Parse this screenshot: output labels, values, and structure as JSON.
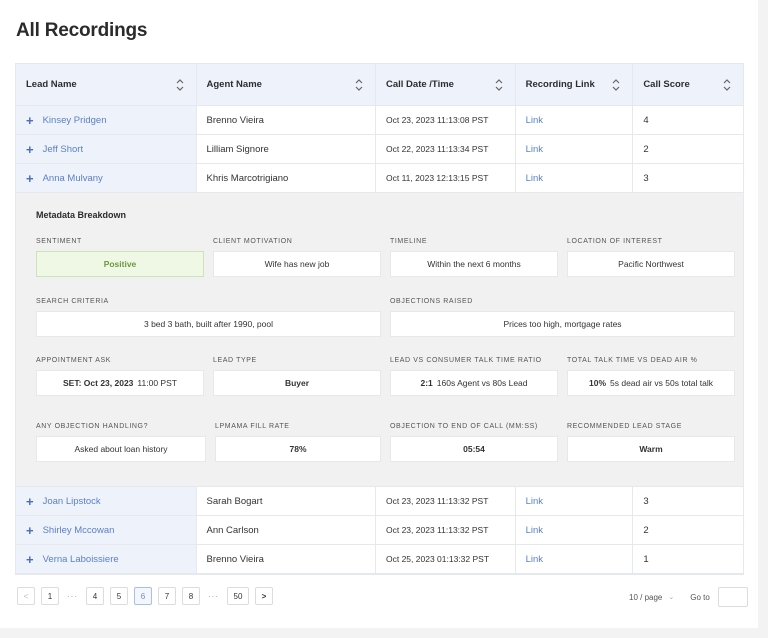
{
  "page": {
    "title": "All Recordings"
  },
  "table": {
    "columns": [
      {
        "label": "Lead Name"
      },
      {
        "label": "Agent Name"
      },
      {
        "label": "Call Date /Time"
      },
      {
        "label": "Recording Link"
      },
      {
        "label": "Call Score"
      }
    ],
    "rows_top": [
      {
        "lead": "Kinsey Pridgen",
        "agent": "Brenno Vieira",
        "date": "Oct 23, 2023  11:13:08 PST",
        "link": "Link",
        "score": "4"
      },
      {
        "lead": "Jeff Short",
        "agent": "Lilliam Signore",
        "date": "Oct 22, 2023  11:13:34 PST",
        "link": "Link",
        "score": "2"
      },
      {
        "lead": "Anna Mulvany",
        "agent": "Khris Marcotrigiano",
        "date": "Oct 11, 2023  12:13:15 PST",
        "link": "Link",
        "score": "3"
      }
    ],
    "rows_bottom": [
      {
        "lead": "Joan Lipstock",
        "agent": "Sarah Bogart",
        "date": "Oct 23, 2023  11:13:32 PST",
        "link": "Link",
        "score": "3"
      },
      {
        "lead": "Shirley Mccowan",
        "agent": "Ann Carlson",
        "date": "Oct 23, 2023  11:13:32 PST",
        "link": "Link",
        "score": "2"
      },
      {
        "lead": "Verna Laboissiere",
        "agent": "Brenno Vieira",
        "date": "Oct 25, 2023 01:13:32 PST",
        "link": "Link",
        "score": "1"
      }
    ],
    "expand_icon": "+"
  },
  "metadata": {
    "title": "Metadata Breakdown",
    "sentiment": {
      "label": "Sentiment",
      "value": "Positive",
      "color": "#6a9a3e"
    },
    "client_motivation": {
      "label": "Client Motivation",
      "value": "Wife has new job"
    },
    "timeline": {
      "label": "Timeline",
      "value": "Within the next 6 months"
    },
    "location": {
      "label": "Location of Interest",
      "value": "Pacific Northwest"
    },
    "search_criteria": {
      "label": "Search Criteria",
      "value": "3 bed 3 bath, built after 1990, pool"
    },
    "objections": {
      "label": "Objections Raised",
      "value": "Prices too high, mortgage rates"
    },
    "appointment": {
      "label": "Appointment Ask",
      "bold": "SET: Oct 23, 2023",
      "value": "11:00 PST"
    },
    "lead_type": {
      "label": "Lead Type",
      "value": "Buyer"
    },
    "talk_ratio": {
      "label": "Lead vs Consumer Talk Time Ratio",
      "bold": "2:1",
      "value": "160s Agent vs 80s Lead"
    },
    "dead_air": {
      "label": "Total Talk Time vs Dead Air %",
      "bold": "10%",
      "value": "5s dead air vs 50s total talk"
    },
    "objection_handling": {
      "label": "Any Objection Handling?",
      "value": "Asked about loan history"
    },
    "lpmama": {
      "label": "LPMAMA Fill Rate",
      "value": "78%"
    },
    "objection_to_end": {
      "label": "Objection to End of Call (MM:SS)",
      "value": "05:54"
    },
    "lead_stage": {
      "label": "Recommended Lead Stage",
      "value": "Warm"
    }
  },
  "pagination": {
    "prev": "<",
    "next": ">",
    "pages": [
      "1",
      "4",
      "5",
      "6",
      "7",
      "8",
      "50"
    ],
    "ellipsis": "···",
    "current": "6",
    "page_size": "10 / page",
    "goto_label": "Go to",
    "goto_value": ""
  },
  "colors": {
    "link": "#5b7fc7",
    "header_bg": "#eef3fb",
    "positive_bg": "#eef8e4"
  }
}
